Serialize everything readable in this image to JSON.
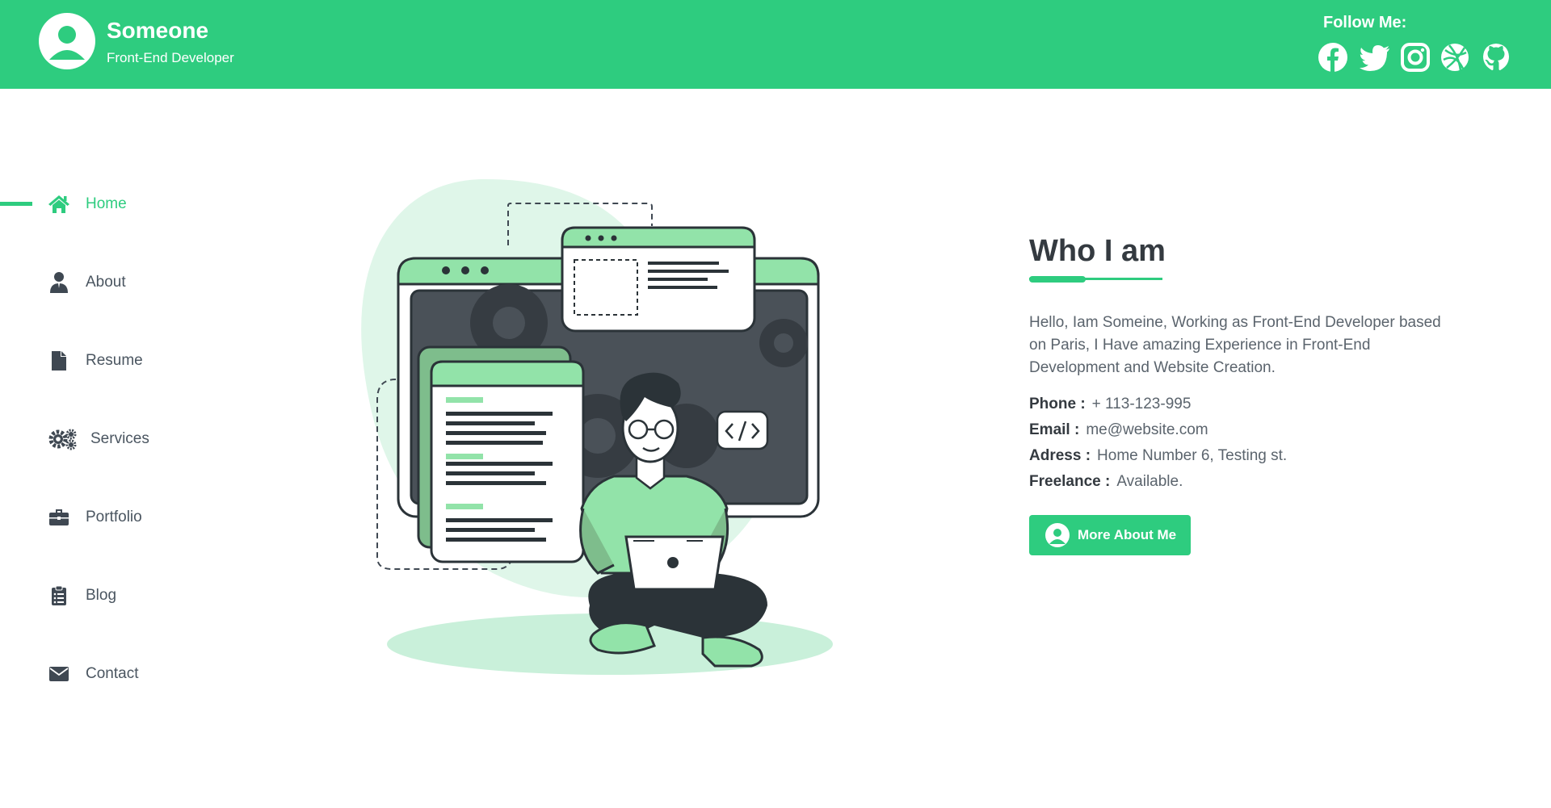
{
  "header": {
    "name": "Someone",
    "role": "Front-End Developer",
    "follow_label": "Follow Me:",
    "social_icons": [
      "facebook-icon",
      "twitter-icon",
      "instagram-icon",
      "dribbble-icon",
      "github-icon"
    ]
  },
  "sidebar": {
    "items": [
      {
        "label": "Home",
        "icon": "home-icon",
        "active": true
      },
      {
        "label": "About",
        "icon": "user-icon"
      },
      {
        "label": "Resume",
        "icon": "file-icon"
      },
      {
        "label": "Services",
        "icon": "gears-icon"
      },
      {
        "label": "Portfolio",
        "icon": "briefcase-icon"
      },
      {
        "label": "Blog",
        "icon": "clipboard-list-icon"
      },
      {
        "label": "Contact",
        "icon": "envelope-icon"
      }
    ]
  },
  "about": {
    "title": "Who I am",
    "text": "Hello, Iam Someine, Working as Front-End Developer based on Paris, I Have amazing Experience in Front-End Development and Website Creation.",
    "info": [
      {
        "key": "Phone :",
        "value": "+ 113-123-995"
      },
      {
        "key": "Email :",
        "value": "me@website.com"
      },
      {
        "key": "Adress :",
        "value": "Home Number 6, Testing st."
      },
      {
        "key": "Freelance :",
        "value": "Available."
      }
    ],
    "button_label": "More About Me"
  },
  "colors": {
    "accent": "#2ecc7f",
    "text_dark": "#343a40",
    "text_muted": "#5b646d",
    "light_green": "#d9f5e6"
  }
}
